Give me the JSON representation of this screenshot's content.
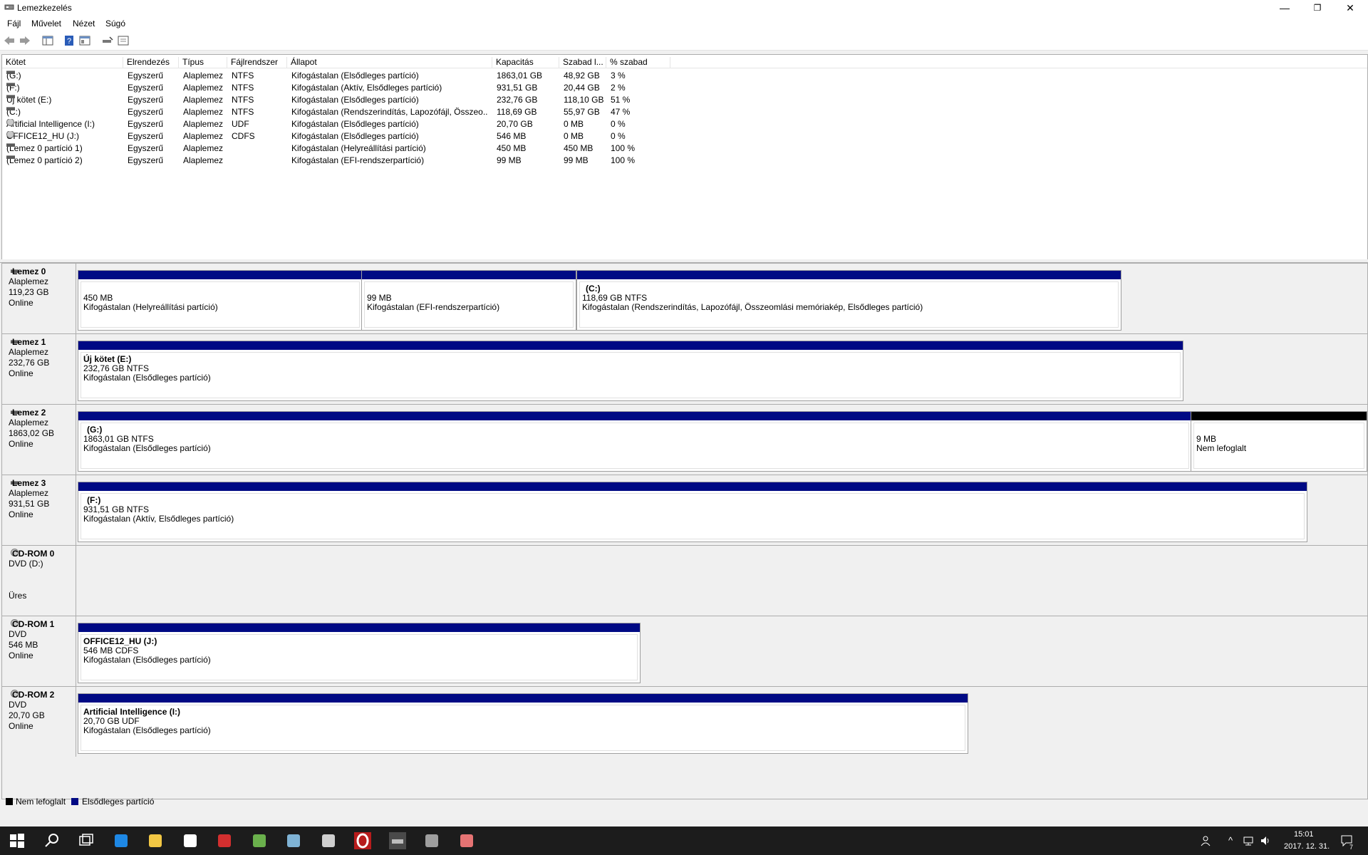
{
  "window": {
    "title": "Lemezkezelés",
    "min": "—",
    "max": "❐",
    "close": "✕"
  },
  "menu": [
    "Fájl",
    "Művelet",
    "Nézet",
    "Súgó"
  ],
  "columns": [
    "Kötet",
    "Elrendezés",
    "Típus",
    "Fájlrendszer",
    "Állapot",
    "Kapacitás",
    "Szabad l...",
    "% szabad"
  ],
  "volumes": [
    {
      "name": "(G:)",
      "layout": "Egyszerű",
      "type": "Alaplemez",
      "fs": "NTFS",
      "status": "Kifogástalan (Elsődleges partíció)",
      "capacity": "1863,01 GB",
      "free": "48,92 GB",
      "pct": "3 %",
      "icon": "disk"
    },
    {
      "name": "(F:)",
      "layout": "Egyszerű",
      "type": "Alaplemez",
      "fs": "NTFS",
      "status": "Kifogástalan (Aktív, Elsődleges partíció)",
      "capacity": "931,51 GB",
      "free": "20,44 GB",
      "pct": "2 %",
      "icon": "disk"
    },
    {
      "name": "Új kötet (E:)",
      "layout": "Egyszerű",
      "type": "Alaplemez",
      "fs": "NTFS",
      "status": "Kifogástalan (Elsődleges partíció)",
      "capacity": "232,76 GB",
      "free": "118,10 GB",
      "pct": "51 %",
      "icon": "disk"
    },
    {
      "name": "(C:)",
      "layout": "Egyszerű",
      "type": "Alaplemez",
      "fs": "NTFS",
      "status": "Kifogástalan (Rendszerindítás, Lapozófájl, Összeo...",
      "capacity": "118,69 GB",
      "free": "55,97 GB",
      "pct": "47 %",
      "icon": "disk"
    },
    {
      "name": "Artificial Intelligence (I:)",
      "layout": "Egyszerű",
      "type": "Alaplemez",
      "fs": "UDF",
      "status": "Kifogástalan (Elsődleges partíció)",
      "capacity": "20,70 GB",
      "free": "0 MB",
      "pct": "0 %",
      "icon": "cd"
    },
    {
      "name": "OFFICE12_HU (J:)",
      "layout": "Egyszerű",
      "type": "Alaplemez",
      "fs": "CDFS",
      "status": "Kifogástalan (Elsődleges partíció)",
      "capacity": "546 MB",
      "free": "0 MB",
      "pct": "0 %",
      "icon": "cd"
    },
    {
      "name": "(Lemez 0 partíció 1)",
      "layout": "Egyszerű",
      "type": "Alaplemez",
      "fs": "",
      "status": "Kifogástalan (Helyreállítási partíció)",
      "capacity": "450 MB",
      "free": "450 MB",
      "pct": "100 %",
      "icon": "disk"
    },
    {
      "name": "(Lemez 0 partíció 2)",
      "layout": "Egyszerű",
      "type": "Alaplemez",
      "fs": "",
      "status": "Kifogástalan (EFI-rendszerpartíció)",
      "capacity": "99 MB",
      "free": "99 MB",
      "pct": "100 %",
      "icon": "disk"
    }
  ],
  "disks": [
    {
      "name": "Lemez 0",
      "l1": "Alaplemez",
      "l2": "119,23 GB",
      "l3": "Online",
      "l4": "",
      "kind": "disk",
      "parts": [
        {
          "title": "",
          "l1": "450 MB",
          "l2": "Kifogástalan (Helyreállítási partíció)",
          "unalloc": false
        },
        {
          "title": "",
          "l1": "99 MB",
          "l2": "Kifogástalan (EFI-rendszerpartíció)",
          "unalloc": false
        },
        {
          "title": "(C:)",
          "l1": "118,69 GB NTFS",
          "l2": "Kifogástalan (Rendszerindítás, Lapozófájl, Összeomlási memóriakép, Elsődleges partíció)",
          "unalloc": false
        }
      ]
    },
    {
      "name": "Lemez 1",
      "l1": "Alaplemez",
      "l2": "232,76 GB",
      "l3": "Online",
      "l4": "",
      "kind": "disk",
      "parts": [
        {
          "title": "Új kötet  (E:)",
          "l1": "232,76 GB NTFS",
          "l2": "Kifogástalan (Elsődleges partíció)",
          "unalloc": false
        }
      ]
    },
    {
      "name": "Lemez 2",
      "l1": "Alaplemez",
      "l2": "1863,02 GB",
      "l3": "Online",
      "l4": "",
      "kind": "disk",
      "parts": [
        {
          "title": "(G:)",
          "l1": "1863,01 GB NTFS",
          "l2": "Kifogástalan (Elsődleges partíció)",
          "unalloc": false
        },
        {
          "title": "",
          "l1": "9 MB",
          "l2": "Nem lefoglalt",
          "unalloc": true
        }
      ]
    },
    {
      "name": "Lemez 3",
      "l1": "Alaplemez",
      "l2": "931,51 GB",
      "l3": "Online",
      "l4": "",
      "kind": "disk",
      "parts": [
        {
          "title": "(F:)",
          "l1": "931,51 GB NTFS",
          "l2": "Kifogástalan (Aktív, Elsődleges partíció)",
          "unalloc": false
        }
      ]
    },
    {
      "name": "CD-ROM 0",
      "l1": "DVD (D:)",
      "l2": "",
      "l3": "",
      "l4": "Üres",
      "kind": "cd",
      "parts": []
    },
    {
      "name": "CD-ROM 1",
      "l1": "DVD",
      "l2": "546 MB",
      "l3": "Online",
      "l4": "",
      "kind": "cd",
      "parts": [
        {
          "title": "OFFICE12_HU  (J:)",
          "l1": "546 MB CDFS",
          "l2": "Kifogástalan (Elsődleges partíció)",
          "unalloc": false
        }
      ]
    },
    {
      "name": "CD-ROM 2",
      "l1": "DVD",
      "l2": "20,70 GB",
      "l3": "Online",
      "l4": "",
      "kind": "cd",
      "parts": [
        {
          "title": "Artificial Intelligence  (I:)",
          "l1": "20,70 GB UDF",
          "l2": "Kifogástalan (Elsődleges partíció)",
          "unalloc": false
        }
      ]
    }
  ],
  "legend": {
    "unallocated": "Nem lefoglalt",
    "primary": "Elsődleges partíció"
  },
  "colors": {
    "primary": "#000a84",
    "unallocated": "#000000",
    "taskbar": "#1c1c1c"
  },
  "taskbar": {
    "time": "15:01",
    "date": "2017. 12. 31.",
    "notif_count": "7",
    "apps": [
      "start-icon",
      "search-icon",
      "task-view-icon",
      "edge-icon",
      "file-explorer-icon",
      "store-icon",
      "media-player-icon",
      "utorrent-icon",
      "notes-icon",
      "calculator-icon",
      "opera-icon",
      "disk-management-icon",
      "network-drive-icon",
      "cloud-drive-icon"
    ]
  }
}
